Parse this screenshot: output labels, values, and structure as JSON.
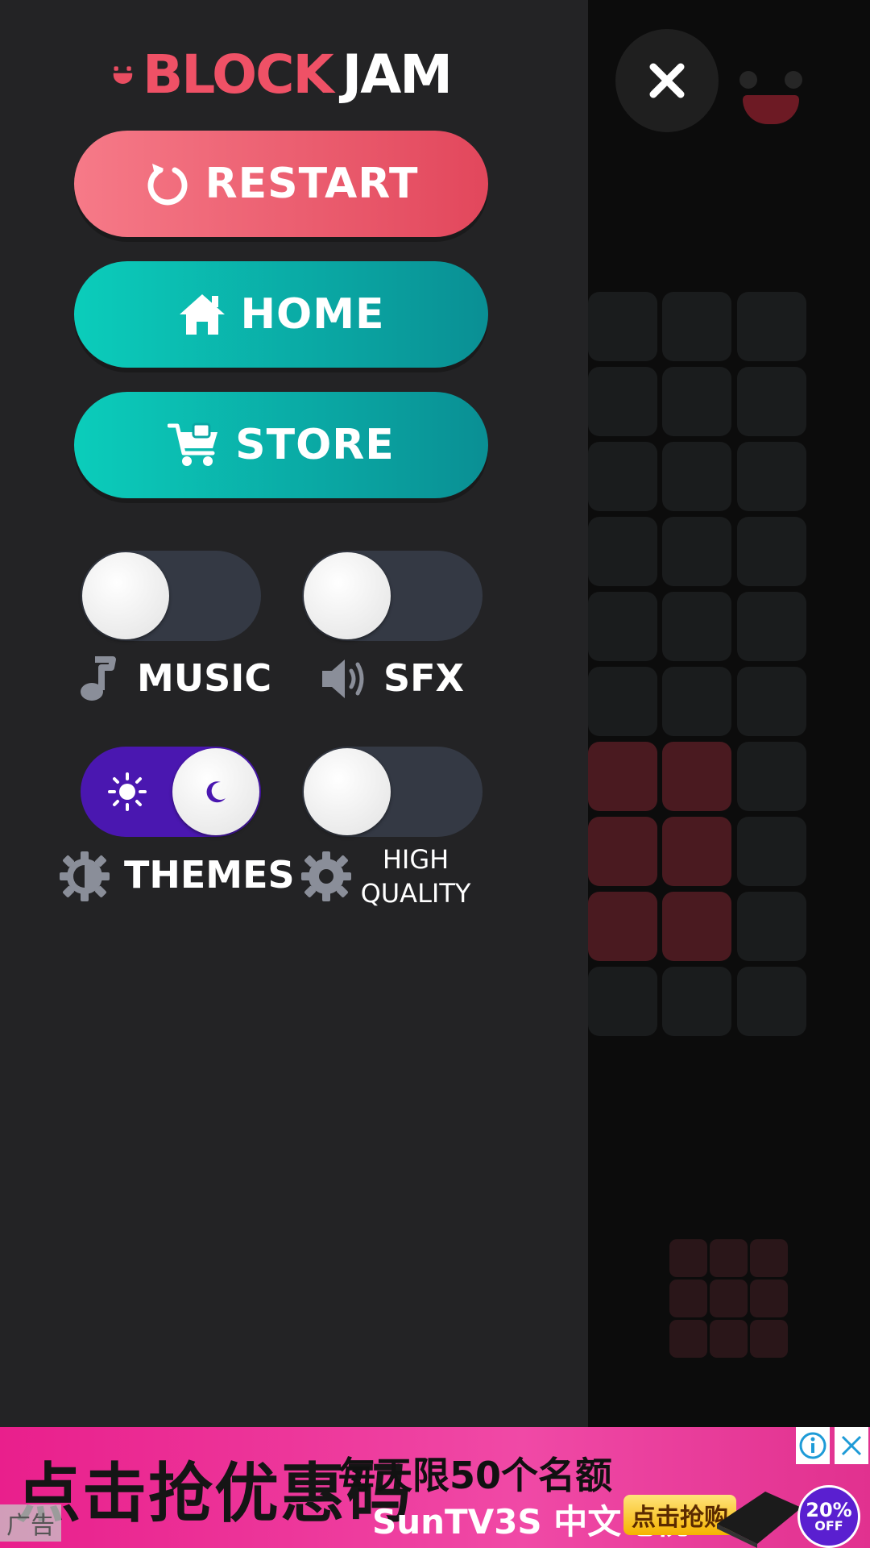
{
  "logo": {
    "part1": "BLOCK",
    "part2": "JAM"
  },
  "menu": {
    "restart_label": "RESTART",
    "home_label": "HOME",
    "store_label": "STORE"
  },
  "settings": {
    "music": {
      "label": "MUSIC",
      "on": false
    },
    "sfx": {
      "label": "SFX",
      "on": false
    },
    "themes": {
      "label": "THEMES",
      "on": true
    },
    "high_quality": {
      "label_line1": "HIGH",
      "label_line2": "QUALITY",
      "on": false
    }
  },
  "ad": {
    "headline": "点击抢优惠码",
    "line1": "每天限50个名额",
    "line2": "SunTV3S 中文电视",
    "cta": "点击抢购",
    "badge_percent": "20%",
    "badge_off": "OFF",
    "tag": "广告"
  },
  "colors": {
    "restart": "#e94d61",
    "teal": "#0bbfb5",
    "theme_on": "#4a17b0",
    "ad_bg": "#ec2e95"
  },
  "icons": {
    "restart": "restart-icon",
    "home": "home-icon",
    "store": "cart-icon",
    "music": "music-note-icon",
    "sfx": "speaker-icon",
    "themes": "theme-gear-icon",
    "quality": "gear-icon",
    "close": "close-icon"
  }
}
